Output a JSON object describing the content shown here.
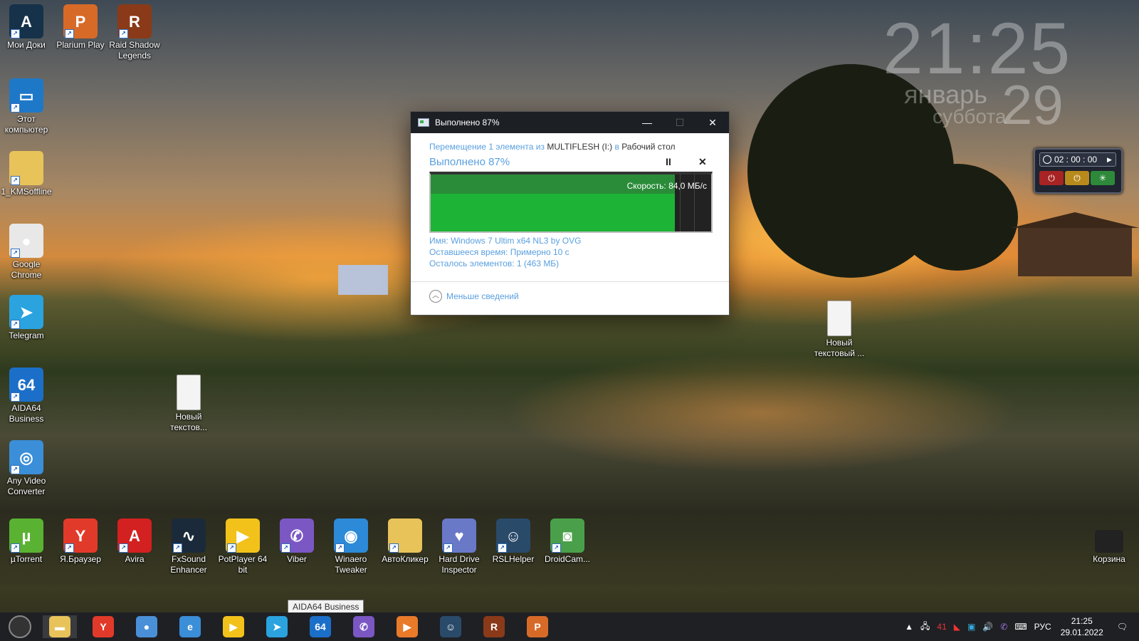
{
  "clock_gadget": {
    "time": "21:25",
    "month": "январь",
    "weekday": "суббота",
    "day": "29"
  },
  "timer_gadget": {
    "value": "02 : 00 : 00"
  },
  "desktop_icons_left": [
    {
      "label": "Мои Доки",
      "color": "#16324a",
      "glyph": "A"
    },
    {
      "label": "Этот компьютер",
      "color": "#1e78c8",
      "glyph": "▭"
    },
    {
      "label": "1_KMSoffline",
      "color": "#e8c35a",
      "glyph": ""
    },
    {
      "label": "Google Chrome",
      "color": "#e8e8e8",
      "glyph": "●"
    },
    {
      "label": "Telegram",
      "color": "#2aa3df",
      "glyph": "➤"
    },
    {
      "label": "AIDA64 Business",
      "color": "#1b6fc8",
      "glyph": "64"
    },
    {
      "label": "Any Video Converter",
      "color": "#3b8ed8",
      "glyph": "◎"
    }
  ],
  "desktop_icons_top": [
    {
      "label": "Plarium Play",
      "color": "#d86a28",
      "glyph": "P"
    },
    {
      "label": "Raid Shadow Legends",
      "color": "#8a3a18",
      "glyph": "R"
    }
  ],
  "desktop_icons_bottom": [
    {
      "label": "µTorrent",
      "color": "#5ab232",
      "glyph": "µ"
    },
    {
      "label": "Я.Браузер",
      "color": "#e23a2a",
      "glyph": "Y"
    },
    {
      "label": "Avira",
      "color": "#d32020",
      "glyph": "A"
    },
    {
      "label": "FxSound Enhancer",
      "color": "#1a2a3a",
      "glyph": "∿"
    },
    {
      "label": "PotPlayer 64 bit",
      "color": "#f2c21b",
      "glyph": "▶"
    },
    {
      "label": "Viber",
      "color": "#7b57c4",
      "glyph": "✆"
    },
    {
      "label": "Winaero Tweaker",
      "color": "#2c8ad8",
      "glyph": "◉"
    },
    {
      "label": "АвтоКликер",
      "color": "#e8c35a",
      "glyph": ""
    },
    {
      "label": "Hard Drive Inspector",
      "color": "#6a78c8",
      "glyph": "♥"
    },
    {
      "label": "RSLHelper",
      "color": "#2a4a6a",
      "glyph": "☺"
    },
    {
      "label": "DroidCam...",
      "color": "#4aa04a",
      "glyph": "◙"
    }
  ],
  "desktop_icons_other": [
    {
      "label": "Новый текстов...",
      "color": "#f4f4f4",
      "glyph": ""
    },
    {
      "label": "Новый текстовый ...",
      "color": "#f4f4f4",
      "glyph": ""
    },
    {
      "label": "Корзина",
      "color": "#222",
      "glyph": ""
    }
  ],
  "dialog": {
    "title": "Выполнено 87%",
    "line1_prefix": "Перемещение 1 элемента из",
    "source": "MULTIFLESH (I:)",
    "line1_mid": "в",
    "destination": "Рабочий стол",
    "percent_text": "Выполнено 87%",
    "progress": 0.87,
    "speed": "Скорость: 84,0 МБ/с",
    "name_label": "Имя:",
    "name_value": "Windows 7 Ultim x64 NL3 by OVG",
    "time_label": "Оставшееся время:",
    "time_value": "Примерно 10 с",
    "items_label": "Осталось элементов:",
    "items_value": "1 (463 МБ)",
    "less_details": "Меньше сведений"
  },
  "tooltip": "AIDA64 Business",
  "taskbar": {
    "apps": [
      {
        "name": "file-explorer",
        "color": "#e8c35a",
        "glyph": "▬"
      },
      {
        "name": "yandex-browser",
        "color": "#e23a2a",
        "glyph": "Y"
      },
      {
        "name": "chrome",
        "color": "#4a90d9",
        "glyph": "●"
      },
      {
        "name": "internet-explorer",
        "color": "#3b8ed8",
        "glyph": "e"
      },
      {
        "name": "potplayer",
        "color": "#f2c21b",
        "glyph": "▶"
      },
      {
        "name": "telegram",
        "color": "#2aa3df",
        "glyph": "➤"
      },
      {
        "name": "aida64",
        "color": "#1b6fc8",
        "glyph": "64"
      },
      {
        "name": "viber",
        "color": "#7b57c4",
        "glyph": "✆"
      },
      {
        "name": "media-player",
        "color": "#e87a2a",
        "glyph": "▶"
      },
      {
        "name": "rsl-helper",
        "color": "#2a4a6a",
        "glyph": "☺"
      },
      {
        "name": "raid",
        "color": "#8a3a18",
        "glyph": "R"
      },
      {
        "name": "plarium",
        "color": "#d86a28",
        "glyph": "P"
      }
    ],
    "tray_number": "41",
    "language": "РУС",
    "time": "21:25",
    "date": "29.01.2022"
  }
}
